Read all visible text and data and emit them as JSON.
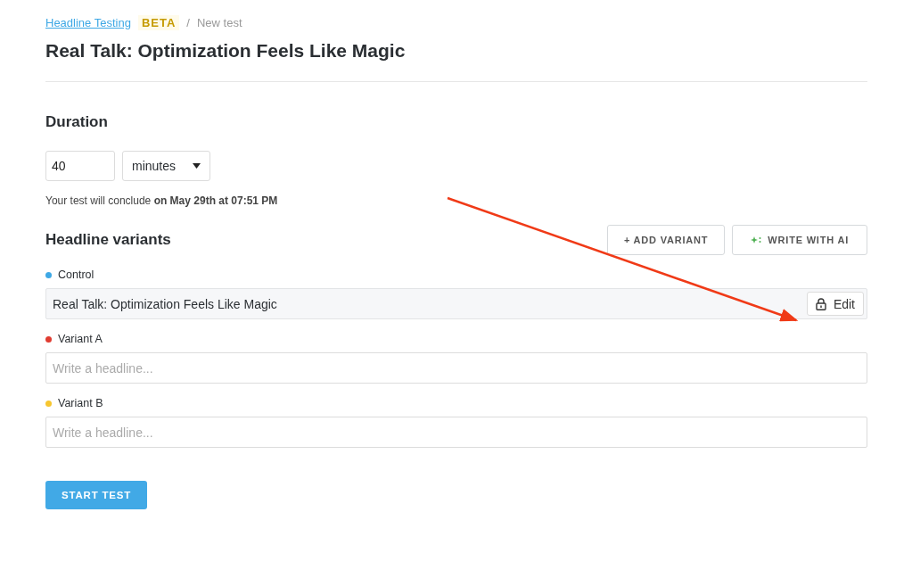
{
  "breadcrumb": {
    "link": "Headline Testing",
    "badge": "BETA",
    "separator": "/",
    "current": "New test"
  },
  "title": "Real Talk: Optimization Feels Like Magic",
  "duration": {
    "heading": "Duration",
    "value": "40",
    "unit": "minutes",
    "conclusion": "Your test will conclude **on May 29th at 07:51 PM**"
  },
  "variants_section": {
    "heading": "Headline variants",
    "buttons": [
      "+ ADD VARIANT",
      "WRITE WITH AI"
    ]
  },
  "variants": [
    {
      "label": "Control",
      "color": "#3ea8e5",
      "kind": "locked",
      "value": "Real Talk: Optimization Feels Like Magic",
      "edit_label": "Edit"
    },
    {
      "label": "Variant A",
      "color": "#e03c31",
      "kind": "input",
      "placeholder": "Write a headline..."
    },
    {
      "label": "Variant B",
      "color": "#f7c62f",
      "kind": "input",
      "placeholder": "Write a headline..."
    }
  ],
  "start_button": "START TEST"
}
